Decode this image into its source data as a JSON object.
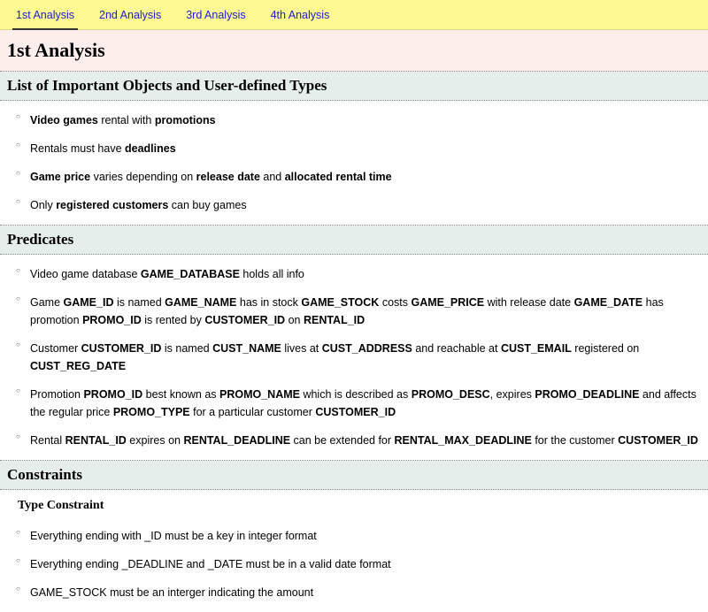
{
  "tabs": [
    {
      "label": "1st Analysis",
      "active": true
    },
    {
      "label": "2nd Analysis",
      "active": false
    },
    {
      "label": "3rd Analysis",
      "active": false
    },
    {
      "label": "4th Analysis",
      "active": false
    }
  ],
  "page_title": "1st Analysis",
  "sections": {
    "objects": {
      "heading": "List of Important Objects and User-defined Types",
      "items": [
        [
          {
            "b": true,
            "t": "Video games"
          },
          {
            "b": false,
            "t": " rental with "
          },
          {
            "b": true,
            "t": "promotions"
          }
        ],
        [
          {
            "b": false,
            "t": "Rentals must have "
          },
          {
            "b": true,
            "t": "deadlines"
          }
        ],
        [
          {
            "b": true,
            "t": "Game price"
          },
          {
            "b": false,
            "t": " varies depending on "
          },
          {
            "b": true,
            "t": "release date"
          },
          {
            "b": false,
            "t": " and "
          },
          {
            "b": true,
            "t": "allocated rental time"
          }
        ],
        [
          {
            "b": false,
            "t": "Only "
          },
          {
            "b": true,
            "t": "registered customers"
          },
          {
            "b": false,
            "t": " can buy games"
          }
        ]
      ]
    },
    "predicates": {
      "heading": "Predicates",
      "items": [
        [
          {
            "b": false,
            "t": "Video game database "
          },
          {
            "b": true,
            "t": "GAME_DATABASE"
          },
          {
            "b": false,
            "t": " holds all info"
          }
        ],
        [
          {
            "b": false,
            "t": "Game "
          },
          {
            "b": true,
            "t": "GAME_ID"
          },
          {
            "b": false,
            "t": " is named "
          },
          {
            "b": true,
            "t": "GAME_NAME"
          },
          {
            "b": false,
            "t": " has in stock "
          },
          {
            "b": true,
            "t": "GAME_STOCK"
          },
          {
            "b": false,
            "t": " costs "
          },
          {
            "b": true,
            "t": "GAME_PRICE"
          },
          {
            "b": false,
            "t": " with release date "
          },
          {
            "b": true,
            "t": "GAME_DATE"
          },
          {
            "b": false,
            "t": " has promotion "
          },
          {
            "b": true,
            "t": "PROMO_ID"
          },
          {
            "b": false,
            "t": " is rented by "
          },
          {
            "b": true,
            "t": "CUSTOMER_ID"
          },
          {
            "b": false,
            "t": " on "
          },
          {
            "b": true,
            "t": "RENTAL_ID"
          }
        ],
        [
          {
            "b": false,
            "t": "Customer "
          },
          {
            "b": true,
            "t": "CUSTOMER_ID"
          },
          {
            "b": false,
            "t": " is named "
          },
          {
            "b": true,
            "t": "CUST_NAME"
          },
          {
            "b": false,
            "t": " lives at "
          },
          {
            "b": true,
            "t": "CUST_ADDRESS"
          },
          {
            "b": false,
            "t": " and reachable at "
          },
          {
            "b": true,
            "t": "CUST_EMAIL"
          },
          {
            "b": false,
            "t": " registered on "
          },
          {
            "b": true,
            "t": "CUST_REG_DATE"
          }
        ],
        [
          {
            "b": false,
            "t": "Promotion "
          },
          {
            "b": true,
            "t": "PROMO_ID"
          },
          {
            "b": false,
            "t": " best known as "
          },
          {
            "b": true,
            "t": "PROMO_NAME"
          },
          {
            "b": false,
            "t": " which is described as "
          },
          {
            "b": true,
            "t": "PROMO_DESC"
          },
          {
            "b": false,
            "t": ", expires "
          },
          {
            "b": true,
            "t": "PROMO_DEADLINE"
          },
          {
            "b": false,
            "t": " and affects the regular price "
          },
          {
            "b": true,
            "t": "PROMO_TYPE"
          },
          {
            "b": false,
            "t": " for a particular customer "
          },
          {
            "b": true,
            "t": "CUSTOMER_ID"
          }
        ],
        [
          {
            "b": false,
            "t": "Rental "
          },
          {
            "b": true,
            "t": "RENTAL_ID"
          },
          {
            "b": false,
            "t": " expires on "
          },
          {
            "b": true,
            "t": "RENTAL_DEADLINE"
          },
          {
            "b": false,
            "t": " can be extended for "
          },
          {
            "b": true,
            "t": "RENTAL_MAX_DEADLINE"
          },
          {
            "b": false,
            "t": " for the customer "
          },
          {
            "b": true,
            "t": "CUSTOMER_ID"
          }
        ]
      ]
    },
    "constraints": {
      "heading": "Constraints",
      "sub_heading": "Type Constraint",
      "items": [
        [
          {
            "b": false,
            "t": "Everything ending with _ID must be a key in integer format"
          }
        ],
        [
          {
            "b": false,
            "t": "Everything ending _DEADLINE and _DATE must be in a valid date format"
          }
        ],
        [
          {
            "b": false,
            "t": "GAME_STOCK must be an interger indicating the amount"
          }
        ]
      ]
    }
  }
}
